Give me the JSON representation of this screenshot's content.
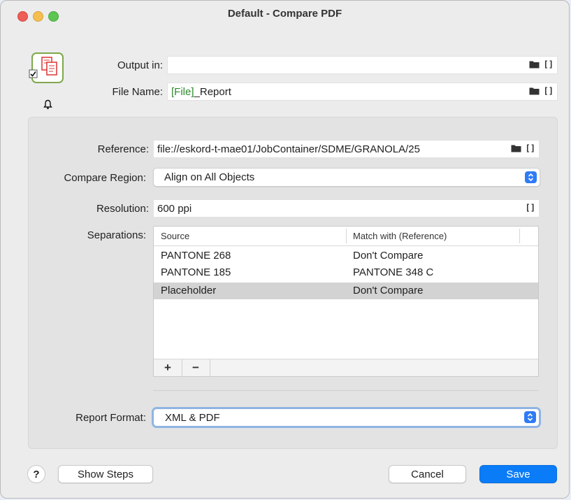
{
  "window": {
    "title": "Default - Compare PDF"
  },
  "output": {
    "output_in_label": "Output in:",
    "output_in_value": "",
    "file_name_label": "File Name:",
    "file_name_token": "[File]",
    "file_name_suffix": "_Report"
  },
  "panel": {
    "reference_label": "Reference:",
    "reference_value": "file://eskord-t-mae01/JobContainer/SDME/GRANOLA/25",
    "compare_region_label": "Compare Region:",
    "compare_region_value": "Align on All Objects",
    "resolution_label": "Resolution:",
    "resolution_value": "600 ppi",
    "separations_label": "Separations:",
    "table": {
      "headers": [
        "Source",
        "Match with (Reference)"
      ],
      "rows": [
        {
          "source": "PANTONE 268",
          "match": "Don't Compare"
        },
        {
          "source": "PANTONE 185",
          "match": "PANTONE 348 C"
        },
        {
          "source": "Placeholder",
          "match": "Don't Compare"
        }
      ],
      "selected_row": 2,
      "add_label": "+",
      "remove_label": "−"
    },
    "report_format_label": "Report Format:",
    "report_format_value": "XML & PDF"
  },
  "footer": {
    "help_label": "?",
    "show_steps_label": "Show Steps",
    "cancel_label": "Cancel",
    "save_label": "Save"
  },
  "colors": {
    "accent": "#0a7cf7",
    "variable_token": "#2c8a2c",
    "icon_border": "#7ea84a"
  }
}
